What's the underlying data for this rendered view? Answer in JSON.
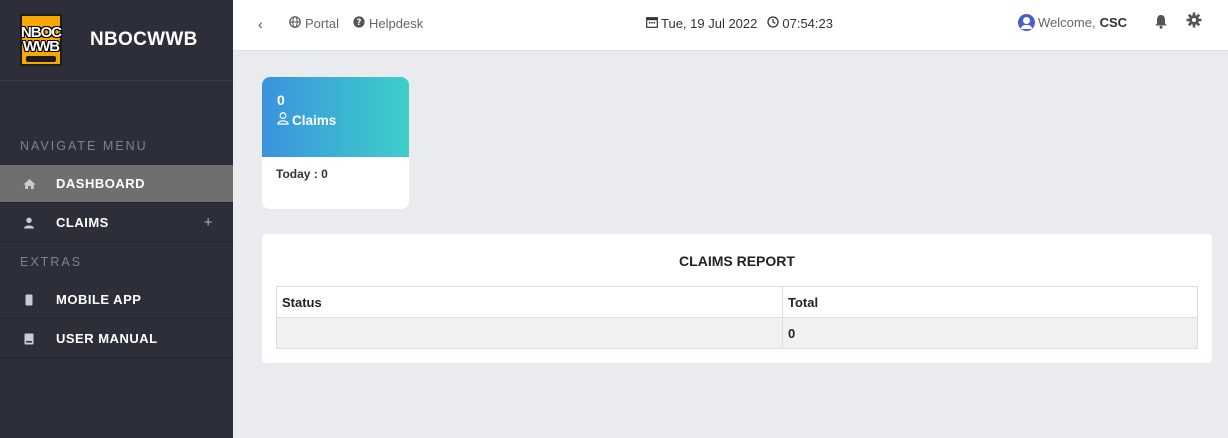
{
  "brand": {
    "logo_top": "NBOC",
    "logo_bottom": "WWB",
    "name": "NBOCWWB"
  },
  "sidebar": {
    "section_navigate": "NAVIGATE MENU",
    "section_extras": "EXTRAS",
    "items": [
      {
        "label": "DASHBOARD",
        "icon": "home-icon",
        "active": true
      },
      {
        "label": "CLAIMS",
        "icon": "user-icon",
        "expand": "+"
      },
      {
        "label": "MOBILE APP",
        "icon": "mobile-icon"
      },
      {
        "label": "USER MANUAL",
        "icon": "book-icon"
      }
    ]
  },
  "topbar": {
    "back": "‹",
    "portal": "Portal",
    "helpdesk": "Helpdesk",
    "date": "Tue, 19 Jul 2022",
    "time": "07:54:23",
    "welcome": "Welcome,",
    "user": "CSC"
  },
  "card": {
    "count": "0",
    "label": "Claims",
    "today": "Today : 0",
    "gradient_start": "#3a93dd",
    "gradient_end": "#3ecfca"
  },
  "report": {
    "title": "CLAIMS REPORT",
    "columns": [
      "Status",
      "Total"
    ],
    "rows": [
      [
        "",
        "0"
      ]
    ]
  }
}
